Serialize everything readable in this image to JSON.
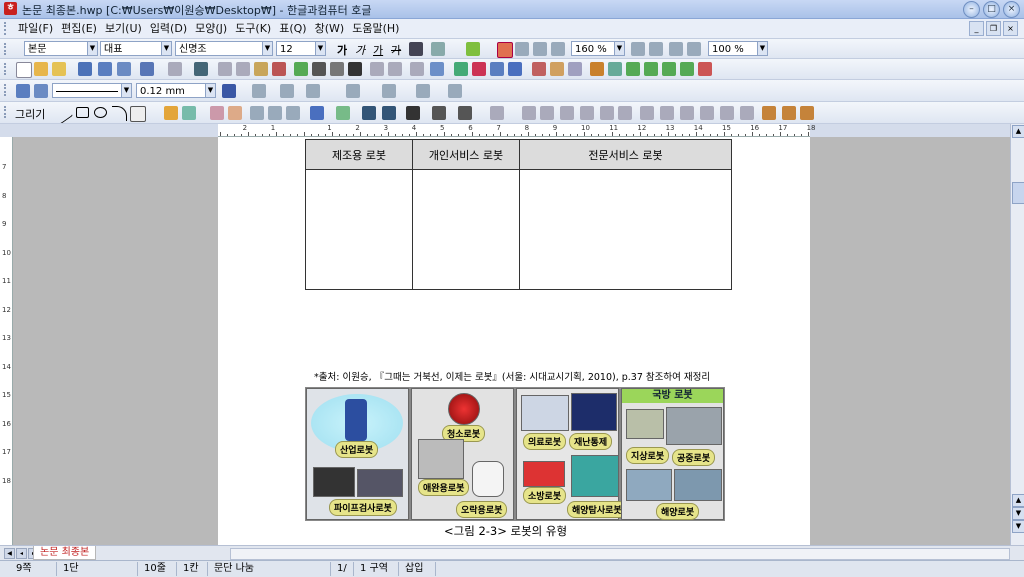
{
  "window": {
    "title": "논문 최종본.hwp [C:₩Users₩이원승₩Desktop₩] - 한글과컴퓨터 호글"
  },
  "menus": [
    "파일(F)",
    "편집(E)",
    "보기(U)",
    "입력(D)",
    "모양(J)",
    "도구(K)",
    "표(Q)",
    "창(W)",
    "도움말(H)"
  ],
  "format_toolbar": {
    "style": "본문",
    "font_lang": "대표",
    "font": "신명조",
    "size": "12",
    "line_spacing": "160 %",
    "zoom": "100 %",
    "bold": "가",
    "italic": "가",
    "underline": "가",
    "strike": "가"
  },
  "draw_toolbar": {
    "label": "그리기",
    "line_width": "0.12 mm"
  },
  "ruler": {
    "labels": [
      "2",
      "1",
      "1",
      "2",
      "3",
      "4",
      "5",
      "6",
      "7",
      "8",
      "9",
      "10",
      "11",
      "12",
      "13",
      "14",
      "15",
      "16",
      "17",
      "18"
    ]
  },
  "vruler": {
    "labels": [
      "7",
      "8",
      "9",
      "10",
      "11",
      "12",
      "13",
      "14",
      "15",
      "16",
      "17",
      "18"
    ]
  },
  "table": {
    "headers": [
      "제조용 로봇",
      "개인서비스 로봇",
      "전문서비스 로봇"
    ]
  },
  "source_note": "*출처: 이원승, 『그때는 거북선, 이제는 로봇』(서울: 시대교시기획, 2010), p.37 참조하여 재정리",
  "figure": {
    "labels": [
      "산업로봇",
      "파이프검사로봇",
      "청소로봇",
      "애완용로봇",
      "오락용로봇",
      "의료로봇",
      "재난통제",
      "소방로봇",
      "해양탐사로봇",
      "국방 로봇",
      "지상로봇",
      "공중로봇",
      "해양로봇"
    ],
    "caption": "<그림 2-3> 로봇의 유형"
  },
  "tabs": {
    "document": "논문 최종본"
  },
  "status": [
    "9쪽",
    "1단",
    "10줄",
    "1칸",
    "문단 나눔",
    "1/",
    "1 구역",
    "삽입"
  ],
  "colors": {
    "accent": "#c8201e",
    "header_fill": "#dcdcdc",
    "tag_fill": "#e6e48a",
    "military_fill": "#9bd65a"
  }
}
